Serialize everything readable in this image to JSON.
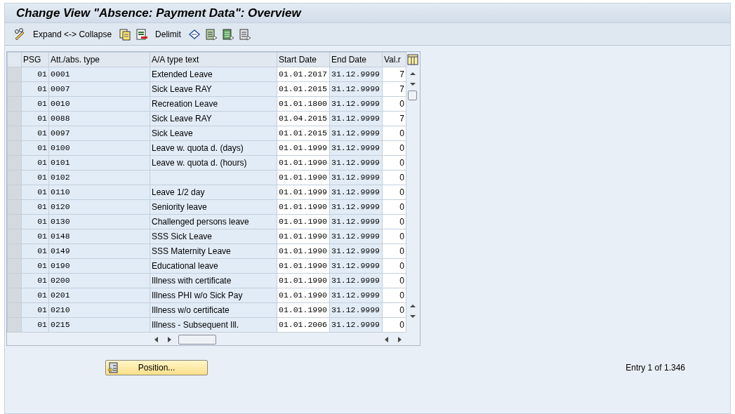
{
  "window": {
    "title": "Change View \"Absence: Payment Data\": Overview"
  },
  "toolbar": [
    {
      "kind": "icon"
    },
    {
      "kind": "text",
      "label": "Expand <-> Collapse"
    },
    {
      "kind": "icon"
    },
    {
      "kind": "icon"
    },
    {
      "kind": "text",
      "label": "Delimit"
    },
    {
      "kind": "icon"
    },
    {
      "kind": "icon"
    },
    {
      "kind": "icon"
    },
    {
      "kind": "icon"
    }
  ],
  "table": {
    "columns": [
      "PSG",
      "Att./abs. type",
      "A/A type text",
      "Start Date",
      "End Date",
      "Val.r"
    ],
    "rows": [
      [
        "01",
        "0001",
        "Extended Leave",
        "01.01.2017",
        "31.12.9999",
        "7"
      ],
      [
        "01",
        "0007",
        "Sick Leave RAY",
        "01.01.2015",
        "31.12.9999",
        "7"
      ],
      [
        "01",
        "0010",
        "Recreation Leave",
        "01.01.1800",
        "31.12.9999",
        "0"
      ],
      [
        "01",
        "0088",
        "Sick Leave RAY",
        "01.04.2015",
        "31.12.9999",
        "7"
      ],
      [
        "01",
        "0097",
        "Sick Leave",
        "01.01.2015",
        "31.12.9999",
        "0"
      ],
      [
        "01",
        "0100",
        "Leave w. quota d. (days)",
        "01.01.1999",
        "31.12.9999",
        "0"
      ],
      [
        "01",
        "0101",
        "Leave w. quota d. (hours)",
        "01.01.1990",
        "31.12.9999",
        "0"
      ],
      [
        "01",
        "0102",
        "",
        "01.01.1990",
        "31.12.9999",
        "0"
      ],
      [
        "01",
        "0110",
        "Leave 1/2 day",
        "01.01.1999",
        "31.12.9999",
        "0"
      ],
      [
        "01",
        "0120",
        "Seniority leave",
        "01.01.1990",
        "31.12.9999",
        "0"
      ],
      [
        "01",
        "0130",
        "Challenged persons leave",
        "01.01.1990",
        "31.12.9999",
        "0"
      ],
      [
        "01",
        "0148",
        "SSS Sick Leave",
        "01.01.1990",
        "31.12.9999",
        "0"
      ],
      [
        "01",
        "0149",
        "SSS Maternity Leave",
        "01.01.1990",
        "31.12.9999",
        "0"
      ],
      [
        "01",
        "0190",
        "Educational leave",
        "01.01.1990",
        "31.12.9999",
        "0"
      ],
      [
        "01",
        "0200",
        "Illness with certificate",
        "01.01.1990",
        "31.12.9999",
        "0"
      ],
      [
        "01",
        "0201",
        "Illness PHI w/o Sick Pay",
        "01.01.1990",
        "31.12.9999",
        "0"
      ],
      [
        "01",
        "0210",
        "Illness w/o certificate",
        "01.01.1990",
        "31.12.9999",
        "0"
      ],
      [
        "01",
        "0215",
        "Illness - Subsequent Ill.",
        "01.01.2006",
        "31.12.9999",
        "0"
      ]
    ]
  },
  "footer": {
    "button": "Position...",
    "entry": "Entry 1 of 1.346"
  }
}
